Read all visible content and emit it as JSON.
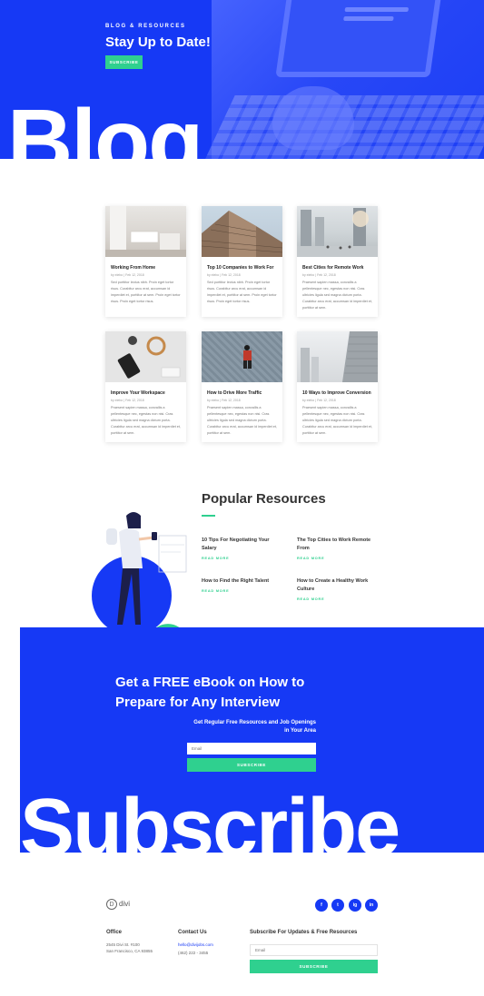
{
  "hero": {
    "kicker": "BLOG & RESOURCES",
    "title": "Stay Up to Date!",
    "button": "SUBSCRIBE",
    "big_word": "Blog"
  },
  "posts": [
    {
      "title": "Working From Home",
      "meta": "by elebo | Feb 12, 2018",
      "excerpt": "Sed porttitor lectus nibh. Proin eget tortor risus. Curabitur arcu erat, accumsan id imperdiet et, porttitor at sem. Proin eget tortor risus. Proin eget tortor risus."
    },
    {
      "title": "Top 10 Companies to Work For",
      "meta": "by elebo | Feb 12, 2018",
      "excerpt": "Sed porttitor lectus nibh. Proin eget tortor risus. Curabitur arcu erat, accumsan id imperdiet et, porttitor at sem. Proin eget tortor risus. Proin eget tortor risus."
    },
    {
      "title": "Best Cities for Remote Work",
      "meta": "by elebo | Feb 12, 2018",
      "excerpt": "Praesent sapien massa, convallis a pellentesque nec, egestas non nisi. Cras ultricies ligula sed magna dictum porta. Curabitur arcu erat, accumsan id imperdiet et, porttitor at sem."
    },
    {
      "title": "Improve Your Workspace",
      "meta": "by elebo | Feb 12, 2018",
      "excerpt": "Praesent sapien massa, convallis a pellentesque nec, egestas non nisi. Cras ultricies ligula sed magna dictum porta. Curabitur arcu erat, accumsan id imperdiet et, porttitor at sem."
    },
    {
      "title": "How to Drive More Traffic",
      "meta": "by elebo | Feb 12, 2018",
      "excerpt": "Praesent sapien massa, convallis a pellentesque nec, egestas non nisi. Cras ultricies ligula sed magna dictum porta. Curabitur arcu erat, accumsan id imperdiet et, porttitor at sem."
    },
    {
      "title": "10 Ways to Improve Conversion",
      "meta": "by elebo | Feb 12, 2018",
      "excerpt": "Praesent sapien massa, convallis a pellentesque nec, egestas non nisi. Cras ultricies ligula sed magna dictum porta. Curabitur arcu erat, accumsan id imperdiet et, porttitor at sem."
    }
  ],
  "popular": {
    "title": "Popular Resources",
    "items": [
      {
        "title": "10 Tips For Negotiating Your Salary",
        "link": "READ MORE"
      },
      {
        "title": "The Top Cities to Work Remote From",
        "link": "READ MORE"
      },
      {
        "title": "How to Find the Right Talent",
        "link": "READ MORE"
      },
      {
        "title": "How to Create a Healthy Work Culture",
        "link": "READ MORE"
      }
    ]
  },
  "subscribe": {
    "heading": "Get a FREE eBook on How to Prepare for Any Interview",
    "text": "Get Regular Free Resources and Job Openings in Your Area",
    "email_placeholder": "Email",
    "button": "SUBSCRIBE",
    "big_word": "Subscribe"
  },
  "footer": {
    "logo_letter": "D",
    "logo_text": "divi",
    "social": [
      "f",
      "t",
      "ig",
      "in"
    ],
    "office": {
      "heading": "Office",
      "line1": "2545 Divi St. #100",
      "line2": "San Francisco, CA 93855"
    },
    "contact": {
      "heading": "Contact Us",
      "email": "hello@divijobs.com",
      "phone": "(462) 222 - 3455"
    },
    "newsletter": {
      "heading": "Subscribe For Updates & Free Resources",
      "email_placeholder": "Email",
      "button": "SUBSCRIBE"
    }
  },
  "colors": {
    "brand_blue": "#1639f5",
    "accent_green": "#2fd08f"
  }
}
